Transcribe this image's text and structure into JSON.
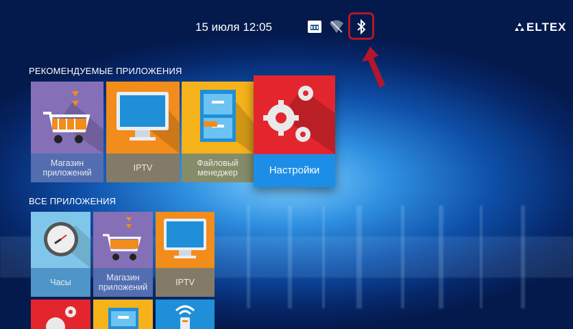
{
  "status_bar": {
    "datetime": "15 июля 12:05",
    "icons": [
      "ethernet-icon",
      "wifi-off-icon",
      "bluetooth-icon"
    ],
    "logo_text": "ELTEX"
  },
  "colors": {
    "highlight": "#b4162c",
    "selected_label_bg": "#1c8ee8",
    "tile_purple": "#8570b8",
    "tile_orange": "#f28c1a",
    "tile_yellow": "#f5b21b",
    "tile_red": "#e3262e",
    "tile_lightblue": "#7fc6ea",
    "tile_blue": "#1f8fd8"
  },
  "recommended": {
    "title": "РЕКОМЕНДУЕМЫЕ ПРИЛОЖЕНИЯ",
    "apps": [
      {
        "label": "Магазин приложений",
        "icon": "shopping-cart-icon"
      },
      {
        "label": "IPTV",
        "icon": "monitor-icon"
      },
      {
        "label": "Файловый менеджер",
        "icon": "file-cabinet-icon"
      },
      {
        "label": "Настройки",
        "icon": "gears-icon",
        "selected": true
      }
    ]
  },
  "all_apps": {
    "title": "ВСЕ ПРИЛОЖЕНИЯ",
    "apps": [
      {
        "label": "Часы",
        "icon": "clock-icon"
      },
      {
        "label": "Магазин приложений",
        "icon": "shopping-cart-icon"
      },
      {
        "label": "IPTV",
        "icon": "monitor-icon"
      },
      {
        "label": "",
        "icon": "gears-icon"
      },
      {
        "label": "",
        "icon": "file-cabinet-icon"
      },
      {
        "label": "",
        "icon": "wifi-remote-icon"
      }
    ]
  }
}
